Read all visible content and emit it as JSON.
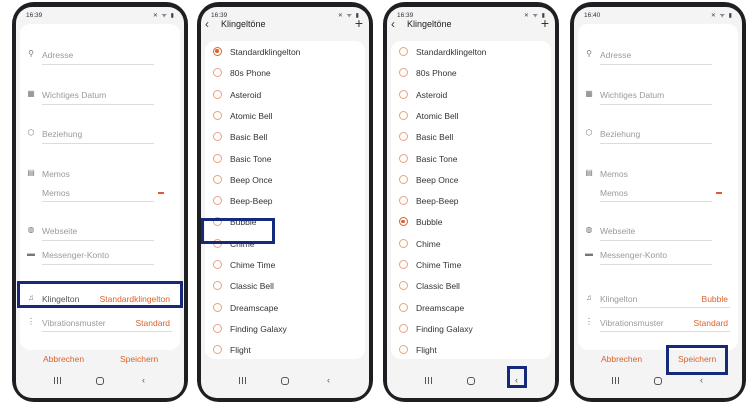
{
  "panel1": {
    "time": "16:39",
    "status_icons": "✕ ᯤ ▮",
    "fields": [
      {
        "icon": "location-icon",
        "glyph": "⬤",
        "label": "Adresse"
      },
      {
        "icon": "calendar-icon",
        "glyph": "▦",
        "label": "Wichtiges Datum"
      },
      {
        "icon": "relationship-icon",
        "glyph": "⬡",
        "label": "Beziehung"
      },
      {
        "icon": "memo-icon",
        "glyph": "▤",
        "label": "Memos"
      },
      {
        "icon": "",
        "glyph": "",
        "label": "Memos"
      },
      {
        "icon": "globe-icon",
        "glyph": "◍",
        "label": "Webseite"
      },
      {
        "icon": "messenger-icon",
        "glyph": "▬",
        "label": "Messenger-Konto"
      }
    ],
    "ringtone": {
      "label": "Klingelton",
      "value": "Standardklingelton"
    },
    "vibration": {
      "label": "Vibrationsmuster",
      "value": "Standard"
    },
    "cancel": "Abbrechen",
    "save": "Speichern"
  },
  "ringtones_screen": {
    "time": "16:39",
    "back": "‹",
    "title": "Klingeltöne",
    "add": "+",
    "items": [
      "Standardklingelton",
      "80s Phone",
      "Asteroid",
      "Atomic Bell",
      "Basic Bell",
      "Basic Tone",
      "Beep Once",
      "Beep-Beep",
      "Bubble",
      "Chime",
      "Chime Time",
      "Classic Bell",
      "Dreamscape",
      "Finding Galaxy",
      "Flight"
    ],
    "panel2_selected": "Standardklingelton",
    "panel3_selected": "Bubble"
  },
  "panel4": {
    "time": "16:40",
    "ringtone_value": "Bubble",
    "vibration_value": "Standard"
  },
  "nav": {
    "back": "‹"
  },
  "colors": {
    "accent": "#d9622b",
    "highlight": "#152a7a"
  }
}
